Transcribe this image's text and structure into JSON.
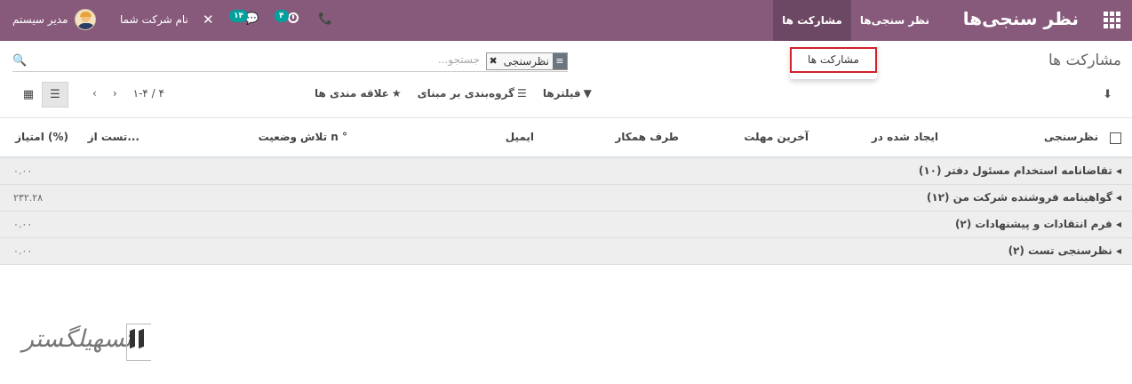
{
  "navbar": {
    "app_title": "نظر سنجی‌ها",
    "menu": [
      {
        "label": "نظر سنجی‌ها",
        "active": false
      },
      {
        "label": "مشارکت ها",
        "active": true
      }
    ],
    "user_name": "مدیر سیستم",
    "company_name": "نام شرکت شما",
    "chat_badge": "۱۴",
    "activity_badge": "۴",
    "bg_color": "#875a7b"
  },
  "dropdown": {
    "item_label": "مشارکت ها"
  },
  "control_panel": {
    "breadcrumb": "مشارکت ها",
    "search": {
      "facet_value": "نظرسنجی",
      "placeholder": "جستجو..."
    },
    "filters_label": "فیلترها",
    "group_by_label": "گروه‌بندی بر مبنای",
    "favorites_label": "علاقه مندی ها",
    "pager_value": "۱-۴ / ۴"
  },
  "table": {
    "columns": [
      "نظرسنجی",
      "ایجاد شده در",
      "آخرین مهلت",
      "طرف همکار",
      "ایمیل",
      "تلاش n °",
      "وضعیت",
      "تست از...",
      "امتیاز (%)"
    ],
    "groups": [
      {
        "title": "تقاضانامه استخدام مسئول دفتر (۱۰)",
        "score": "۰.۰۰"
      },
      {
        "title": "گواهینامه فروشنده شرکت من (۱۲)",
        "score": "۲۳۲.۲۸"
      },
      {
        "title": "فرم انتقادات و پیشنهادات (۲)",
        "score": "۰.۰۰"
      },
      {
        "title": "نظرسنجی تست (۲)",
        "score": "۰.۰۰"
      }
    ]
  },
  "watermark": {
    "text": "تسهیلگستر"
  }
}
